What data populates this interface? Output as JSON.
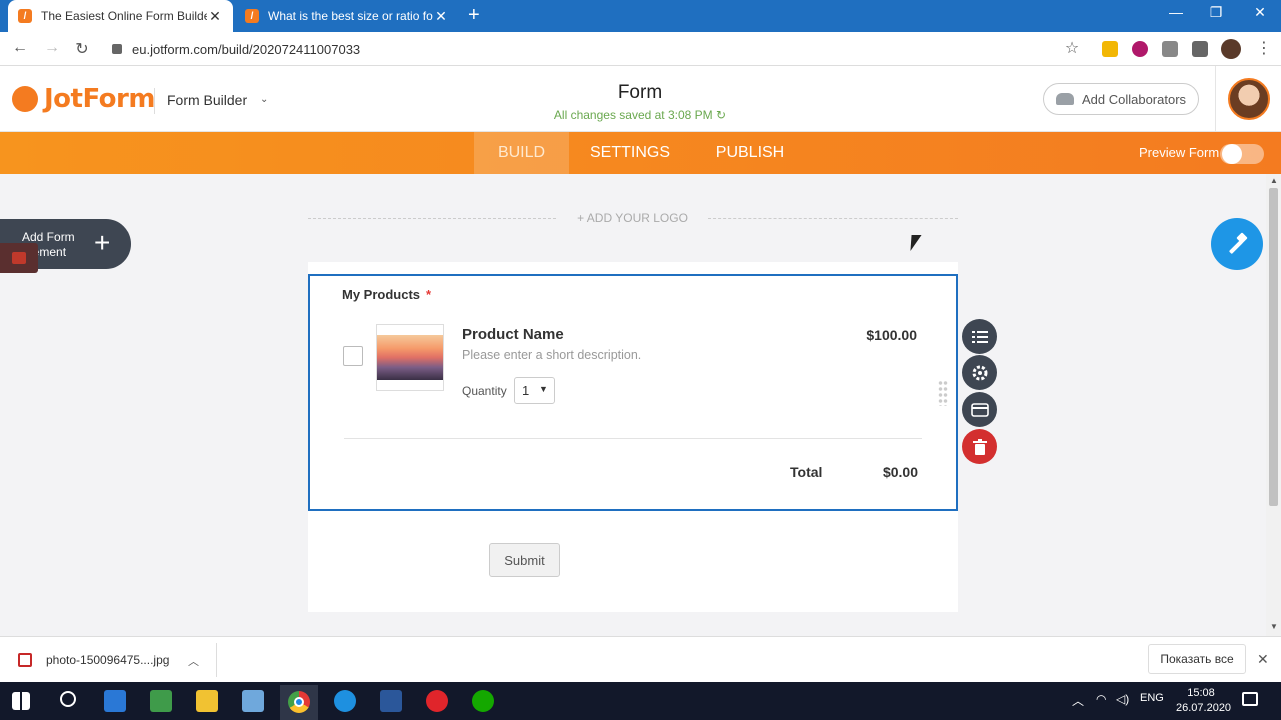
{
  "browser": {
    "tabs": [
      {
        "title": "The Easiest Online Form Builder |",
        "active": true
      },
      {
        "title": "What is the best size or ratio for",
        "active": false
      }
    ],
    "url": "eu.jotform.com/build/202072411007033"
  },
  "header": {
    "logo_text": "JotForm",
    "builder_label": "Form Builder",
    "form_title": "Form",
    "save_status": "All changes saved at 3:08 PM",
    "add_collaborators": "Add Collaborators"
  },
  "nav": {
    "tabs": [
      "BUILD",
      "SETTINGS",
      "PUBLISH"
    ],
    "active_tab": "BUILD",
    "preview_label": "Preview Form"
  },
  "canvas": {
    "add_element": "Add Form Element",
    "add_logo": "+ ADD YOUR LOGO",
    "field_label": "My Products",
    "required_mark": "*",
    "product": {
      "name": "Product Name",
      "description": "Please enter a short description.",
      "price": "$100.00",
      "quantity_label": "Quantity",
      "quantity_value": "1"
    },
    "total_label": "Total",
    "total_value": "$0.00",
    "submit_label": "Submit"
  },
  "downloads": {
    "file": "photo-150096475....jpg",
    "show_all": "Показать все"
  },
  "taskbar": {
    "lang": "ENG",
    "time": "15:08",
    "date": "26.07.2020"
  },
  "colors": {
    "brand_orange": "#f47b20",
    "selection_blue": "#1f6fc0",
    "save_green": "#6aa84f",
    "delete_red": "#d32f2f",
    "wand_blue": "#1e96e6"
  }
}
